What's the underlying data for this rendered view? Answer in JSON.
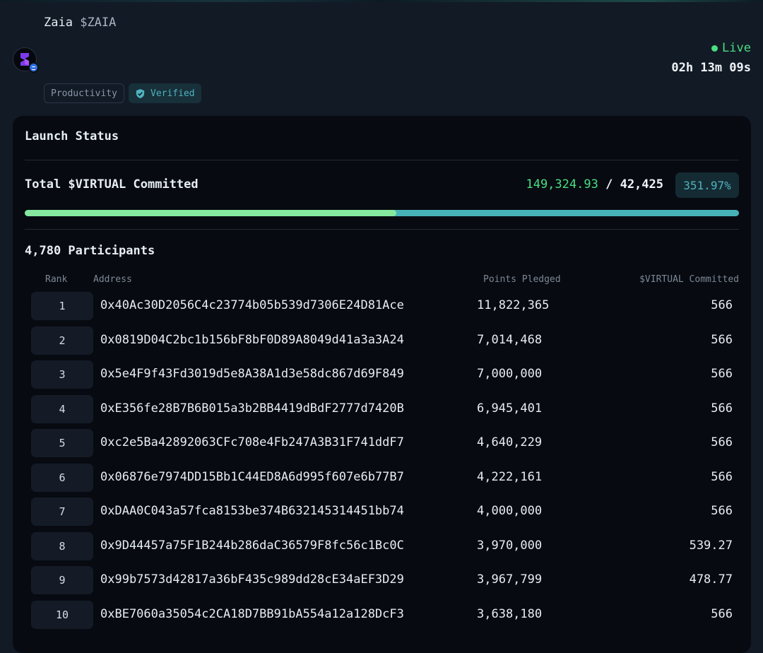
{
  "token": {
    "name": "Zaia",
    "ticker": "$ZAIA",
    "category": "Productivity",
    "verified_label": "Verified"
  },
  "status": {
    "live_label": "Live",
    "countdown": "02h 13m 09s"
  },
  "launch": {
    "title": "Launch Status",
    "committed_label": "Total $VIRTUAL Committed",
    "committed_value": "149,324.93",
    "separator": "/",
    "target_value": "42,425",
    "percent": "351.97%",
    "progress_fill_fraction": 0.52,
    "participants_label": "4,780 Participants"
  },
  "table": {
    "headers": {
      "rank": "Rank",
      "address": "Address",
      "points": "Points Pledged",
      "virtual": "$VIRTUAL Committed"
    },
    "rows": [
      {
        "rank": "1",
        "address": "0x40Ac30D2056C4c23774b05b539d7306E24D81Ace",
        "points": "11,822,365",
        "virtual": "566"
      },
      {
        "rank": "2",
        "address": "0x0819D04C2bc1b156bF8bF0D89A8049d41a3a3A24",
        "points": "7,014,468",
        "virtual": "566"
      },
      {
        "rank": "3",
        "address": "0x5e4F9f43Fd3019d5e8A38A1d3e58dc867d69F849",
        "points": "7,000,000",
        "virtual": "566"
      },
      {
        "rank": "4",
        "address": "0xE356fe28B7B6B015a3b2BB4419dBdF2777d7420B",
        "points": "6,945,401",
        "virtual": "566"
      },
      {
        "rank": "5",
        "address": "0xc2e5Ba42892063CFc708e4Fb247A3B31F741ddF7",
        "points": "4,640,229",
        "virtual": "566"
      },
      {
        "rank": "6",
        "address": "0x06876e7974DD15Bb1C44ED8A6d995f607e6b77B7",
        "points": "4,222,161",
        "virtual": "566"
      },
      {
        "rank": "7",
        "address": "0xDAA0C043a57fca8153be374B632145314451bb74",
        "points": "4,000,000",
        "virtual": "566"
      },
      {
        "rank": "8",
        "address": "0x9D44457a75F1B244b286daC36579F8fc56c1Bc0C",
        "points": "3,970,000",
        "virtual": "539.27"
      },
      {
        "rank": "9",
        "address": "0x99b7573d42817a36bF435c989dd28cE34aEF3D29",
        "points": "3,967,799",
        "virtual": "478.77"
      },
      {
        "rank": "10",
        "address": "0xBE7060a35054c2CA18D7BB91bA554a12a128DcF3",
        "points": "3,638,180",
        "virtual": "566"
      }
    ]
  },
  "colors": {
    "accent_green": "#4ade80",
    "accent_teal": "#4fb3bf",
    "progress_fill": "#86e89e",
    "progress_track": "#46b2b8"
  }
}
